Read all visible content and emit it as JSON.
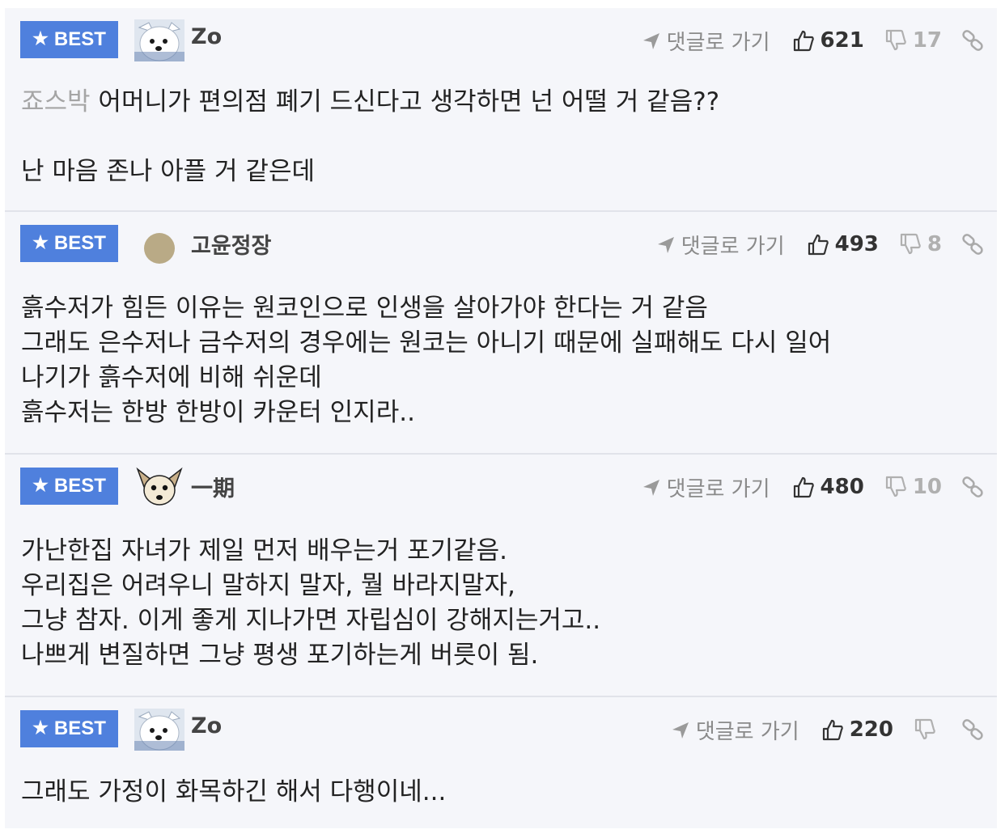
{
  "best_badge_label": "BEST",
  "go_to_reply_label": "댓글로 가기",
  "colors": {
    "badge": "#4f80dd",
    "card_background": "#f5f6fa",
    "mention": "#a5a5a5"
  },
  "comments": [
    {
      "nickname": "Zo",
      "avatar": "white-dog-avatar",
      "likes": "621",
      "dislikes": "17",
      "mention": "죠스박",
      "lines": [
        "어머니가 편의점 폐기 드신다고 생각하면 넌 어떨 거 같음??",
        "",
        "난 마음 존나 아플 거 같은데"
      ]
    },
    {
      "nickname": "고윤정장",
      "avatar": "tan-circle-avatar",
      "likes": "493",
      "dislikes": "8",
      "lines": [
        "흙수저가 힘든 이유는 원코인으로 인생을 살아가야 한다는 거 같음",
        "그래도 은수저나 금수저의 경우에는 원코는 아니기 때문에 실패해도 다시 일어",
        "나기가 흙수저에 비해 쉬운데",
        "흙수저는 한방 한방이 카운터 인지라.."
      ]
    },
    {
      "nickname": "一期",
      "avatar": "fox-dog-avatar",
      "likes": "480",
      "dislikes": "10",
      "lines": [
        "가난한집 자녀가 제일 먼저 배우는거 포기같음.",
        "우리집은 어려우니 말하지 말자, 뭘 바라지말자,",
        "그냥 참자. 이게 좋게 지나가면 자립심이 강해지는거고..",
        "나쁘게 변질하면 그냥 평생 포기하는게 버릇이 됨."
      ]
    },
    {
      "nickname": "Zo",
      "avatar": "white-dog-avatar",
      "likes": "220",
      "dislikes": "",
      "lines": [
        "그래도 가정이 화목하긴 해서 다행이네..."
      ]
    }
  ]
}
